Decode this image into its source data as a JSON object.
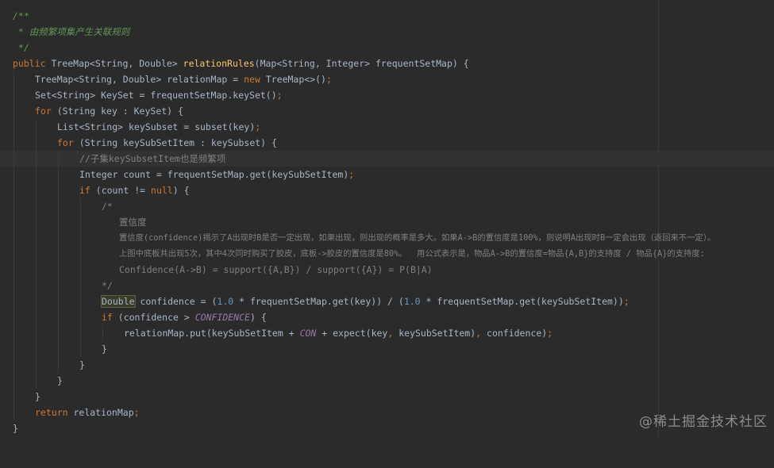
{
  "code": {
    "l1": "/**",
    "l2": " * 由频繁项集产生关联规则",
    "l3": " */",
    "l4a": "public ",
    "l4b": "TreeMap<String, Double> ",
    "l4c": "relationRules",
    "l4d": "(Map<String, Integer> frequentSetMap) {",
    "l5a": "TreeMap<String, Double> relationMap = ",
    "l5b": "new ",
    "l5c": "TreeMap<>()",
    "l5d": ";",
    "l6a": "Set<String> KeySet = frequentSetMap.keySet()",
    "l6b": ";",
    "l7a": "for ",
    "l7b": "(String key : KeySet) {",
    "l8a": "List<String> keySubset = subset(key)",
    "l8b": ";",
    "l9a": "for ",
    "l9b": "(String keySubSetItem : keySubset) {",
    "l10": "//子集keySubsetItem也是频繁项",
    "l11a": "Integer count = frequentSetMap.get(keySubSetItem)",
    "l11b": ";",
    "l12a": "if ",
    "l12b": "(count != ",
    "l12c": "null",
    "l12d": ") {",
    "l13": "/*",
    "l14": "置信度",
    "l15": "置信度(confidence)揭示了A出现时B是否一定出现，如果出现，则出现的概率是多大。如果A->B的置信度是100%，则说明A出现时B一定会出现（返回来不一定）。",
    "l16": "上图中底板共出现5次，其中4次同时购买了胶皮，底板->胶皮的置信度是80%。  用公式表示是，物品A->B的置信度=物品{A,B}的支持度 / 物品{A}的支持度:",
    "l17": "Confidence(A->B) = support({A,B}) / support({A}) = P(B|A)",
    "l18": "*/",
    "l19a": "Double",
    "l19b": " confidence = (",
    "l19c": "1.0",
    "l19d": " * frequentSetMap.get(key)) / (",
    "l19e": "1.0",
    "l19f": " * frequentSetMap.get(keySubSetItem))",
    "l19g": ";",
    "l20a": "if ",
    "l20b": "(confidence > ",
    "l20c": "CONFIDENCE",
    "l20d": ") {",
    "l21a": "relationMap.put(keySubSetItem + ",
    "l21b": "CON",
    "l21c": " + expect(key",
    "l21d": ", ",
    "l21e": "keySubSetItem)",
    "l21f": ", ",
    "l21g": "confidence)",
    "l21h": ";",
    "l22": "}",
    "l23": "}",
    "l24": "}",
    "l25": "}",
    "l26a": "return ",
    "l26b": "relationMap",
    "l26c": ";",
    "l27": "}"
  },
  "watermark": "@稀土掘金技术社区"
}
